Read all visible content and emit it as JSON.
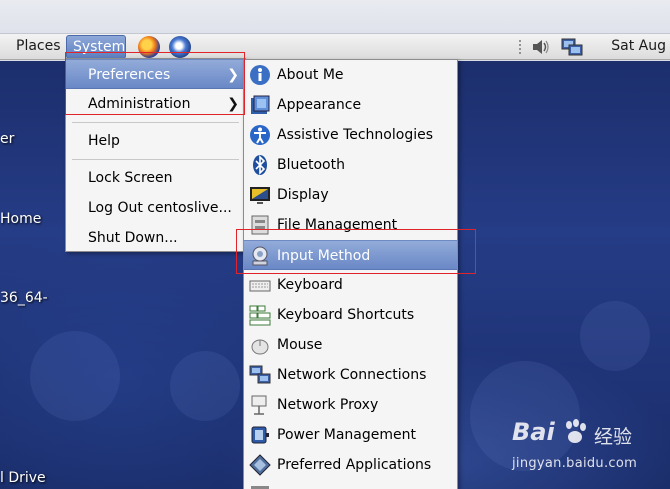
{
  "panel": {
    "places_label": "Places",
    "system_label": "System",
    "clock": "Sat Aug",
    "launchers": [
      "firefox-icon",
      "thunderbird-icon"
    ],
    "tray": [
      "volume-icon",
      "network-icon"
    ]
  },
  "desktop": {
    "labels": [
      "er",
      "Home",
      "36_64-",
      "l Drive"
    ]
  },
  "system_menu": {
    "items": [
      {
        "label": "Preferences",
        "submenu": true
      },
      {
        "label": "Administration",
        "submenu": true
      },
      {
        "label": "Help"
      },
      {
        "label": "Lock Screen"
      },
      {
        "label": "Log Out centoslive..."
      },
      {
        "label": "Shut Down..."
      }
    ]
  },
  "preferences_menu": {
    "items": [
      {
        "label": "About Me",
        "icon": "about-me-icon"
      },
      {
        "label": "Appearance",
        "icon": "appearance-icon"
      },
      {
        "label": "Assistive Technologies",
        "icon": "accessibility-icon"
      },
      {
        "label": "Bluetooth",
        "icon": "bluetooth-icon"
      },
      {
        "label": "Display",
        "icon": "display-icon"
      },
      {
        "label": "File Management",
        "icon": "file-management-icon"
      },
      {
        "label": "Input Method",
        "icon": "input-method-icon"
      },
      {
        "label": "Keyboard",
        "icon": "keyboard-icon"
      },
      {
        "label": "Keyboard Shortcuts",
        "icon": "keyboard-shortcuts-icon"
      },
      {
        "label": "Mouse",
        "icon": "mouse-icon"
      },
      {
        "label": "Network Connections",
        "icon": "network-connections-icon"
      },
      {
        "label": "Network Proxy",
        "icon": "network-proxy-icon"
      },
      {
        "label": "Power Management",
        "icon": "power-management-icon"
      },
      {
        "label": "Preferred Applications",
        "icon": "preferred-applications-icon"
      }
    ]
  },
  "watermark": {
    "brand": "Bai",
    "brand_cn": "经验",
    "url": "jingyan.baidu.com"
  },
  "colors": {
    "highlight": "#7592cc",
    "annotation": "#e0242a",
    "desktop": "#223777"
  }
}
